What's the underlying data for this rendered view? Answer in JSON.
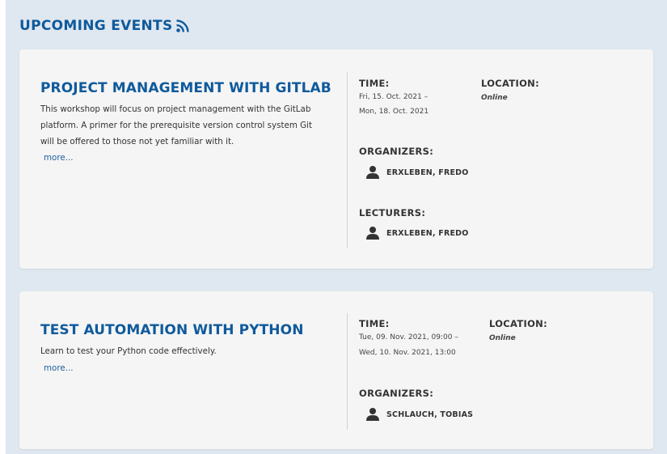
{
  "section": {
    "title": "UPCOMING EVENTS",
    "feed_icon": "rss-icon"
  },
  "labels": {
    "time": "TIME:",
    "location": "LOCATION:",
    "organizers": "ORGANIZERS:",
    "lecturers": "LECTURERS:"
  },
  "events": [
    {
      "title": "PROJECT MANAGEMENT WITH GITLAB",
      "description": "This workshop will focus on project management with the GitLab platform. A primer for the prerequisite version control system Git will be offered to those not yet familiar with it.",
      "more": "more...",
      "time_start": "Fri, 15. Oct. 2021 –",
      "time_end": "Mon, 18. Oct. 2021",
      "location": "Online",
      "organizers": [
        "ERXLEBEN, FREDO"
      ],
      "lecturers": [
        "ERXLEBEN, FREDO"
      ]
    },
    {
      "title": "TEST AUTOMATION WITH PYTHON",
      "description": "Learn to test your Python code effectively.",
      "more": "more...",
      "time_start": "Tue, 09. Nov. 2021, 09:00 –",
      "time_end": "Wed, 10. Nov. 2021, 13:00",
      "location": "Online",
      "organizers": [
        "SCHLAUCH, TOBIAS"
      ]
    }
  ],
  "colors": {
    "accent": "#0f5a9c",
    "panel": "#dfe7f0",
    "card": "#f5f5f5"
  }
}
